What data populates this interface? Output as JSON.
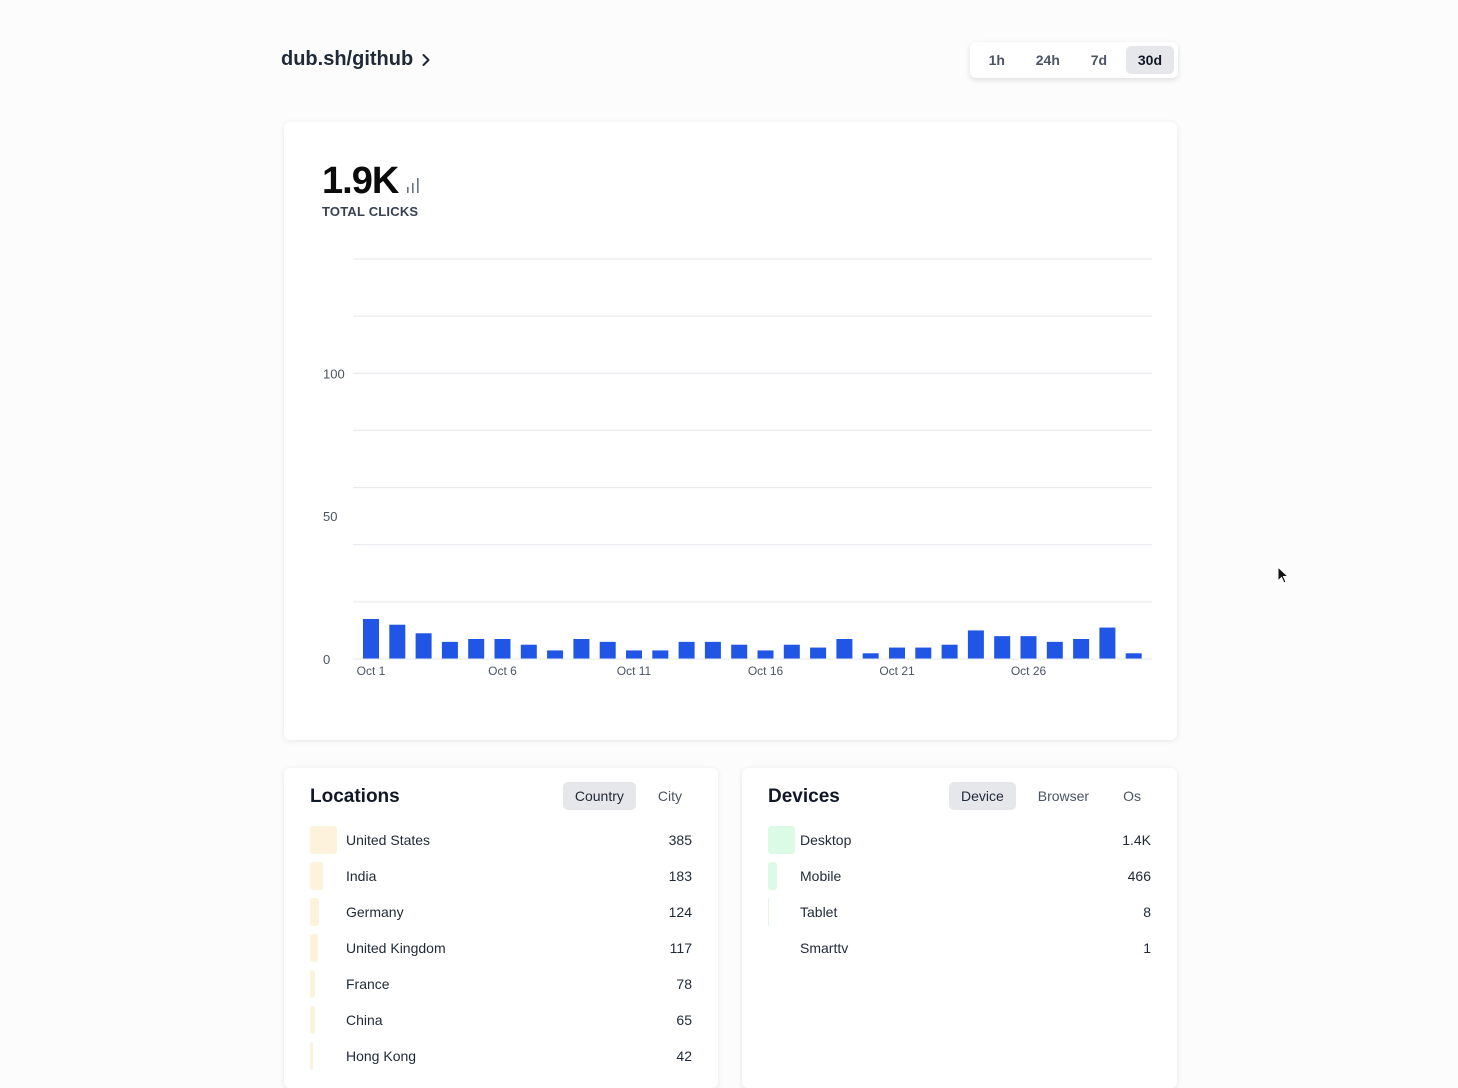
{
  "header": {
    "link": "dub.sh/github",
    "ranges": [
      {
        "label": "1h",
        "active": false
      },
      {
        "label": "24h",
        "active": false
      },
      {
        "label": "7d",
        "active": false
      },
      {
        "label": "30d",
        "active": true
      }
    ]
  },
  "summary": {
    "total": "1.9K",
    "total_label": "TOTAL CLICKS"
  },
  "colors": {
    "bar": "#2155e6",
    "grid": "#e5e7eb",
    "location_fill": "#fdf3dc",
    "device_fill": "#dcfbe6"
  },
  "chart_data": {
    "type": "bar",
    "title": "",
    "xlabel": "",
    "ylabel": "",
    "ylim": [
      0,
      140
    ],
    "yticks": [
      0,
      50,
      100
    ],
    "grid": true,
    "categories": [
      "Oct 1",
      "Oct 2",
      "Oct 3",
      "Oct 4",
      "Oct 5",
      "Oct 6",
      "Oct 7",
      "Oct 8",
      "Oct 9",
      "Oct 10",
      "Oct 11",
      "Oct 12",
      "Oct 13",
      "Oct 14",
      "Oct 15",
      "Oct 16",
      "Oct 17",
      "Oct 18",
      "Oct 19",
      "Oct 20",
      "Oct 21",
      "Oct 22",
      "Oct 23",
      "Oct 24",
      "Oct 25",
      "Oct 26",
      "Oct 27",
      "Oct 28",
      "Oct 29",
      "Oct 30"
    ],
    "xtick_labels": [
      "Oct 1",
      "Oct 6",
      "Oct 11",
      "Oct 16",
      "Oct 21",
      "Oct 26"
    ],
    "values": [
      14,
      12,
      9,
      6,
      7,
      7,
      5,
      3,
      7,
      6,
      3,
      3,
      6,
      6,
      5,
      3,
      5,
      4,
      7,
      2,
      4,
      4,
      5,
      10,
      8,
      8,
      6,
      7,
      11,
      2
    ]
  },
  "locations": {
    "title": "Locations",
    "tabs": [
      {
        "label": "Country",
        "active": true
      },
      {
        "label": "City",
        "active": false
      }
    ],
    "items": [
      {
        "name": "United States",
        "value": "385",
        "count": 385
      },
      {
        "name": "India",
        "value": "183",
        "count": 183
      },
      {
        "name": "Germany",
        "value": "124",
        "count": 124
      },
      {
        "name": "United Kingdom",
        "value": "117",
        "count": 117
      },
      {
        "name": "France",
        "value": "78",
        "count": 78
      },
      {
        "name": "China",
        "value": "65",
        "count": 65
      },
      {
        "name": "Hong Kong",
        "value": "42",
        "count": 42
      }
    ]
  },
  "devices": {
    "title": "Devices",
    "tabs": [
      {
        "label": "Device",
        "active": true
      },
      {
        "label": "Browser",
        "active": false
      },
      {
        "label": "Os",
        "active": false
      }
    ],
    "items": [
      {
        "name": "Desktop",
        "value": "1.4K",
        "count": 1400
      },
      {
        "name": "Mobile",
        "value": "466",
        "count": 466
      },
      {
        "name": "Tablet",
        "value": "8",
        "count": 8
      },
      {
        "name": "Smarttv",
        "value": "1",
        "count": 1
      }
    ]
  }
}
